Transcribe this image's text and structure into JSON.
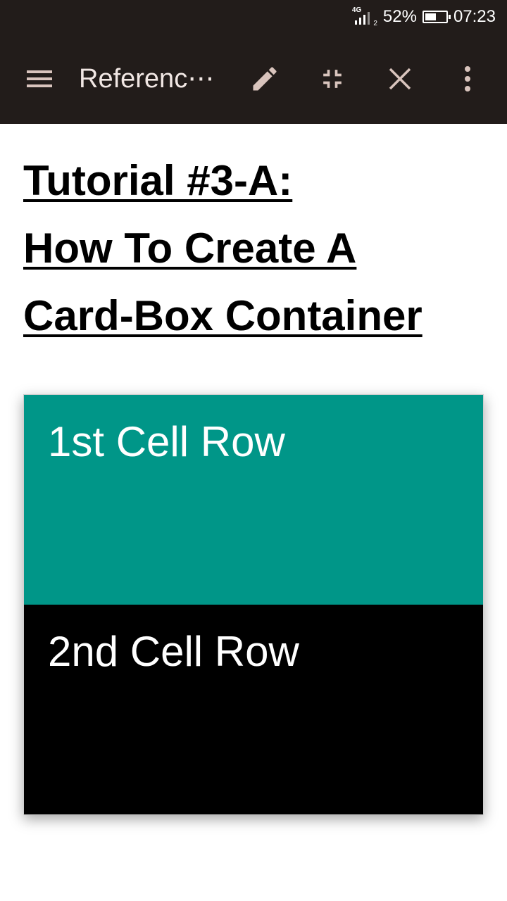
{
  "status_bar": {
    "network_type": "4G",
    "sim_slot": "2",
    "battery_percent_text": "52%",
    "battery_level": 0.52,
    "time": "07:23"
  },
  "toolbar": {
    "menu_icon": "hamburger-menu-icon",
    "title": "Referenc⋯",
    "edit_icon": "pencil-icon",
    "collapse_icon": "fullscreen-exit-icon",
    "close_icon": "close-icon",
    "overflow_icon": "more-vert-icon",
    "background_color": "#221c1a",
    "icon_color": "#d9c4bd"
  },
  "article": {
    "title_lines": [
      "Tutorial #3-A:",
      "How To Create A",
      "Card-Box Container"
    ],
    "card": {
      "rows": [
        {
          "label": "1st Cell Row",
          "background": "#009688"
        },
        {
          "label": "2nd Cell Row",
          "background": "#000000"
        }
      ]
    }
  }
}
